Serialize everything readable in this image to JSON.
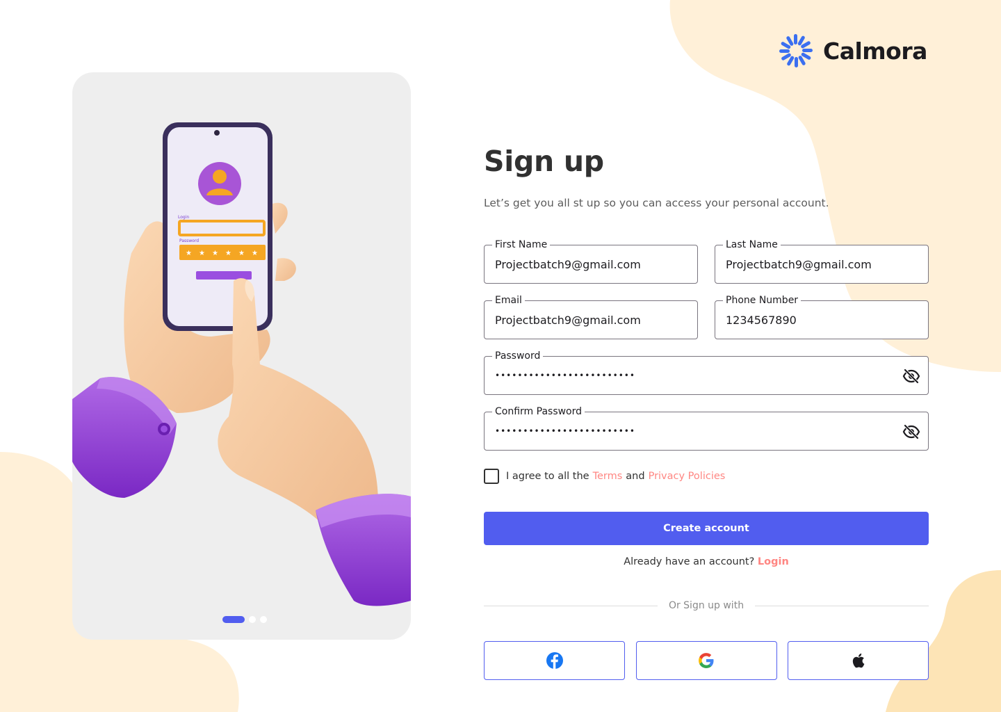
{
  "brand": {
    "name": "Calmora",
    "logo_icon": "sunburst-logo-icon",
    "logo_color": "#3b6ff0"
  },
  "colors": {
    "accent": "#515def",
    "link": "#ff8682",
    "blob": "#fff0d8",
    "card_bg": "#eeeeee"
  },
  "illustration": {
    "description_icon": "phone-login-illustration",
    "phone_screen": {
      "login_label": "Login",
      "password_label": "Password"
    },
    "carousel": {
      "count": 3,
      "active_index": 0
    }
  },
  "form": {
    "title": "Sign up",
    "subtitle": "Let’s get you all st up so you can access your personal account.",
    "first_name": {
      "label": "First Name",
      "value": "Projectbatch9@gmail.com"
    },
    "last_name": {
      "label": "Last Name",
      "value": "Projectbatch9@gmail.com"
    },
    "email": {
      "label": "Email",
      "value": "Projectbatch9@gmail.com"
    },
    "phone": {
      "label": "Phone Number",
      "value": "1234567890"
    },
    "password": {
      "label": "Password",
      "value": "•••••••••••••••••••••••••",
      "toggle_icon": "eye-off-icon"
    },
    "confirm_password": {
      "label": "Confirm Password",
      "value": "•••••••••••••••••••••••••",
      "toggle_icon": "eye-off-icon"
    },
    "terms": {
      "prefix": "I agree to all the",
      "terms_link": "Terms",
      "and": "and",
      "privacy_link": "Privacy Policies",
      "checked": false
    },
    "submit_label": "Create account",
    "login_prompt": {
      "text": "Already have an account?",
      "link": "Login"
    },
    "divider_text": "Or Sign up with",
    "social": [
      {
        "name": "facebook",
        "icon": "facebook-icon"
      },
      {
        "name": "google",
        "icon": "google-icon"
      },
      {
        "name": "apple",
        "icon": "apple-icon"
      }
    ]
  }
}
